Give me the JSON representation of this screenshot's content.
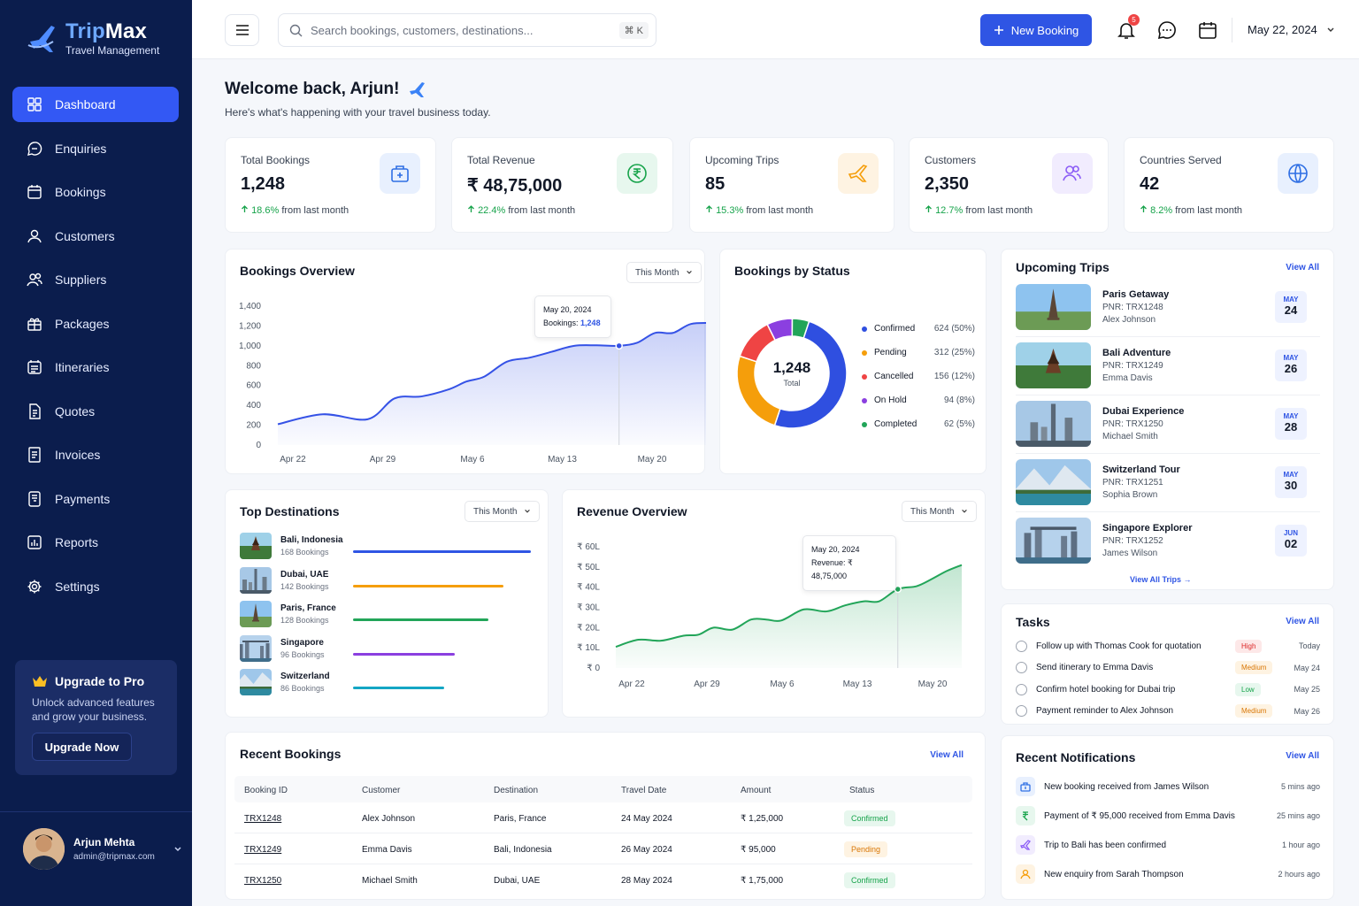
{
  "brand": {
    "name_a": "Trip",
    "name_b": "Max",
    "subtitle": "Travel Management"
  },
  "nav": [
    {
      "label": "Dashboard",
      "icon": "grid-icon",
      "active": true
    },
    {
      "label": "Enquiries",
      "icon": "chat-icon"
    },
    {
      "label": "Bookings",
      "icon": "calendar-icon"
    },
    {
      "label": "Customers",
      "icon": "user-icon"
    },
    {
      "label": "Suppliers",
      "icon": "users-icon"
    },
    {
      "label": "Packages",
      "icon": "gift-icon"
    },
    {
      "label": "Itineraries",
      "icon": "calendar-list-icon"
    },
    {
      "label": "Quotes",
      "icon": "document-icon"
    },
    {
      "label": "Invoices",
      "icon": "invoice-icon"
    },
    {
      "label": "Payments",
      "icon": "payment-icon"
    },
    {
      "label": "Reports",
      "icon": "report-icon"
    },
    {
      "label": "Settings",
      "icon": "gear-icon"
    }
  ],
  "upgrade": {
    "title": "Upgrade to Pro",
    "desc": "Unlock advanced features and grow your business.",
    "button": "Upgrade Now"
  },
  "user": {
    "name": "Arjun Mehta",
    "email": "admin@tripmax.com"
  },
  "topbar": {
    "search_placeholder": "Search bookings, customers, destinations...",
    "shortcut": "⌘ K",
    "new_booking": "New Booking",
    "notif_count": "5",
    "date": "May 22, 2024"
  },
  "welcome": {
    "title": "Welcome back, Arjun!",
    "subtitle": "Here's what's happening with your travel business today."
  },
  "stats": [
    {
      "label": "Total Bookings",
      "value": "1,248",
      "change": "18.6%",
      "suffix": "from last month",
      "icon": "suitcase-icon",
      "color": "#2f6fe4",
      "bg": "#e8f0fe"
    },
    {
      "label": "Total Revenue",
      "value": "₹ 48,75,000",
      "change": "22.4%",
      "suffix": "from last month",
      "icon": "rupee-icon",
      "color": "#16a34a",
      "bg": "#e7f7ee"
    },
    {
      "label": "Upcoming Trips",
      "value": "85",
      "change": "15.3%",
      "suffix": "from last month",
      "icon": "plane-icon",
      "color": "#f59e0b",
      "bg": "#fef3e2"
    },
    {
      "label": "Customers",
      "value": "2,350",
      "change": "12.7%",
      "suffix": "from last month",
      "icon": "users-icon",
      "color": "#8b5cf6",
      "bg": "#f1ecfe"
    },
    {
      "label": "Countries Served",
      "value": "42",
      "change": "8.2%",
      "suffix": "from last month",
      "icon": "globe-icon",
      "color": "#2f6fe4",
      "bg": "#e8f0fe"
    }
  ],
  "bookings_overview": {
    "title": "Bookings Overview",
    "period": "This Month",
    "tooltip_date": "May 20, 2024",
    "tooltip_label": "Bookings:",
    "tooltip_value": "1,248"
  },
  "status": {
    "title": "Bookings by Status",
    "total": "1,248",
    "total_label": "Total"
  },
  "destinations": {
    "title": "Top Destinations",
    "period": "This Month",
    "items": [
      {
        "name": "Bali, Indonesia",
        "bookings": "168 Bookings",
        "color": "#2f55e4"
      },
      {
        "name": "Dubai, UAE",
        "bookings": "142 Bookings",
        "color": "#f59e0b"
      },
      {
        "name": "Paris, France",
        "bookings": "128 Bookings",
        "color": "#22a559"
      },
      {
        "name": "Singapore",
        "bookings": "96 Bookings",
        "color": "#8b3fe0"
      },
      {
        "name": "Switzerland",
        "bookings": "86 Bookings",
        "color": "#14a6c4"
      }
    ]
  },
  "revenue": {
    "title": "Revenue Overview",
    "period": "This Month",
    "tooltip_date": "May 20, 2024",
    "tooltip_text": "Revenue: ₹ 48,75,000"
  },
  "trips": {
    "title": "Upcoming Trips",
    "view_all": "View All",
    "view_all_trips": "View All Trips",
    "items": [
      {
        "name": "Paris Getaway",
        "pnr": "PNR: TRX1248",
        "customer": "Alex Johnson",
        "month": "MAY",
        "day": "24"
      },
      {
        "name": "Bali Adventure",
        "pnr": "PNR: TRX1249",
        "customer": "Emma Davis",
        "month": "MAY",
        "day": "26"
      },
      {
        "name": "Dubai Experience",
        "pnr": "PNR: TRX1250",
        "customer": "Michael Smith",
        "month": "MAY",
        "day": "28"
      },
      {
        "name": "Switzerland Tour",
        "pnr": "PNR: TRX1251",
        "customer": "Sophia Brown",
        "month": "MAY",
        "day": "30"
      },
      {
        "name": "Singapore Explorer",
        "pnr": "PNR: TRX1252",
        "customer": "James Wilson",
        "month": "JUN",
        "day": "02"
      }
    ]
  },
  "tasks": {
    "title": "Tasks",
    "view_all": "View All",
    "items": [
      {
        "text": "Follow up with Thomas Cook for quotation",
        "priority": "High",
        "due": "Today"
      },
      {
        "text": "Send itinerary to Emma Davis",
        "priority": "Medium",
        "due": "May 24"
      },
      {
        "text": "Confirm hotel booking for Dubai trip",
        "priority": "Low",
        "due": "May 25"
      },
      {
        "text": "Payment reminder to Alex Johnson",
        "priority": "Medium",
        "due": "May 26"
      }
    ]
  },
  "recent": {
    "title": "Recent Bookings",
    "view_all": "View All",
    "headers": [
      "Booking ID",
      "Customer",
      "Destination",
      "Travel Date",
      "Amount",
      "Status"
    ],
    "rows": [
      {
        "id": "TRX1248",
        "customer": "Alex Johnson",
        "destination": "Paris, France",
        "date": "24 May 2024",
        "amount": "₹ 1,25,000",
        "status": "Confirmed"
      },
      {
        "id": "TRX1249",
        "customer": "Emma Davis",
        "destination": "Bali, Indonesia",
        "date": "26 May 2024",
        "amount": "₹ 95,000",
        "status": "Pending"
      },
      {
        "id": "TRX1250",
        "customer": "Michael Smith",
        "destination": "Dubai, UAE",
        "date": "28 May 2024",
        "amount": "₹ 1,75,000",
        "status": "Confirmed"
      }
    ]
  },
  "notifications": {
    "title": "Recent Notifications",
    "view_all": "View All",
    "items": [
      {
        "text": "New booking received from James Wilson",
        "time": "5 mins ago",
        "icon": "suitcase-icon"
      },
      {
        "text": "Payment of ₹ 95,000 received from Emma Davis",
        "time": "25 mins ago",
        "icon": "rupee-icon"
      },
      {
        "text": "Trip to Bali has been confirmed",
        "time": "1 hour ago",
        "icon": "plane-icon"
      },
      {
        "text": "New enquiry from Sarah Thompson",
        "time": "2 hours ago",
        "icon": "user-icon"
      }
    ]
  },
  "chart_data": [
    {
      "type": "area",
      "title": "Bookings Overview",
      "x": [
        "Apr 22",
        "Apr 29",
        "May 6",
        "May 13",
        "May 20"
      ],
      "yticks": [
        "0",
        "200",
        "400",
        "600",
        "800",
        "1,000",
        "1,200",
        "1,400"
      ],
      "ylim": [
        0,
        1400
      ],
      "points": [
        [
          0,
          210
        ],
        [
          0.5,
          310
        ],
        [
          1,
          260
        ],
        [
          1.3,
          470
        ],
        [
          1.6,
          490
        ],
        [
          1.9,
          560
        ],
        [
          2.1,
          640
        ],
        [
          2.3,
          690
        ],
        [
          2.55,
          840
        ],
        [
          2.8,
          880
        ],
        [
          3.05,
          940
        ],
        [
          3.3,
          1000
        ],
        [
          3.55,
          1005
        ],
        [
          3.8,
          1000
        ],
        [
          4.0,
          1030
        ],
        [
          4.2,
          1130
        ],
        [
          4.4,
          1130
        ],
        [
          4.6,
          1220
        ],
        [
          4.85,
          1230
        ]
      ]
    },
    {
      "type": "pie",
      "title": "Bookings by Status",
      "slices": [
        {
          "label": "Confirmed",
          "value": 624,
          "pct": "624 (50%)",
          "color": "#2f4fe0"
        },
        {
          "label": "Pending",
          "value": 312,
          "pct": "312 (25%)",
          "color": "#f59e0b"
        },
        {
          "label": "Cancelled",
          "value": 156,
          "pct": "156 (12%)",
          "color": "#ef4444"
        },
        {
          "label": "On Hold",
          "value": 94,
          "pct": "94 (8%)",
          "color": "#8b3fe0"
        },
        {
          "label": "Completed",
          "value": 62,
          "pct": "62 (5%)",
          "color": "#22a559"
        }
      ]
    },
    {
      "type": "bar",
      "title": "Top Destinations",
      "categories": [
        "Bali, Indonesia",
        "Dubai, UAE",
        "Paris, France",
        "Singapore",
        "Switzerland"
      ],
      "values": [
        168,
        142,
        128,
        96,
        86
      ]
    },
    {
      "type": "area",
      "title": "Revenue Overview",
      "x": [
        "Apr 22",
        "Apr 29",
        "May 6",
        "May 13",
        "May 20"
      ],
      "yticks": [
        "₹ 0",
        "₹ 10L",
        "₹ 20L",
        "₹ 30L",
        "₹ 40L",
        "₹ 50L",
        "₹ 60L"
      ],
      "ylim": [
        0,
        60
      ],
      "points": [
        [
          0,
          10.5
        ],
        [
          0.3,
          14
        ],
        [
          0.6,
          13.5
        ],
        [
          0.9,
          16
        ],
        [
          1.1,
          16.5
        ],
        [
          1.3,
          20
        ],
        [
          1.55,
          19
        ],
        [
          1.8,
          24
        ],
        [
          2.0,
          24
        ],
        [
          2.2,
          23.5
        ],
        [
          2.5,
          29
        ],
        [
          2.8,
          28
        ],
        [
          3.05,
          31
        ],
        [
          3.3,
          33
        ],
        [
          3.5,
          33
        ],
        [
          3.75,
          39
        ],
        [
          4.0,
          40.5
        ],
        [
          4.2,
          44
        ],
        [
          4.4,
          48
        ],
        [
          4.6,
          51
        ]
      ]
    }
  ]
}
